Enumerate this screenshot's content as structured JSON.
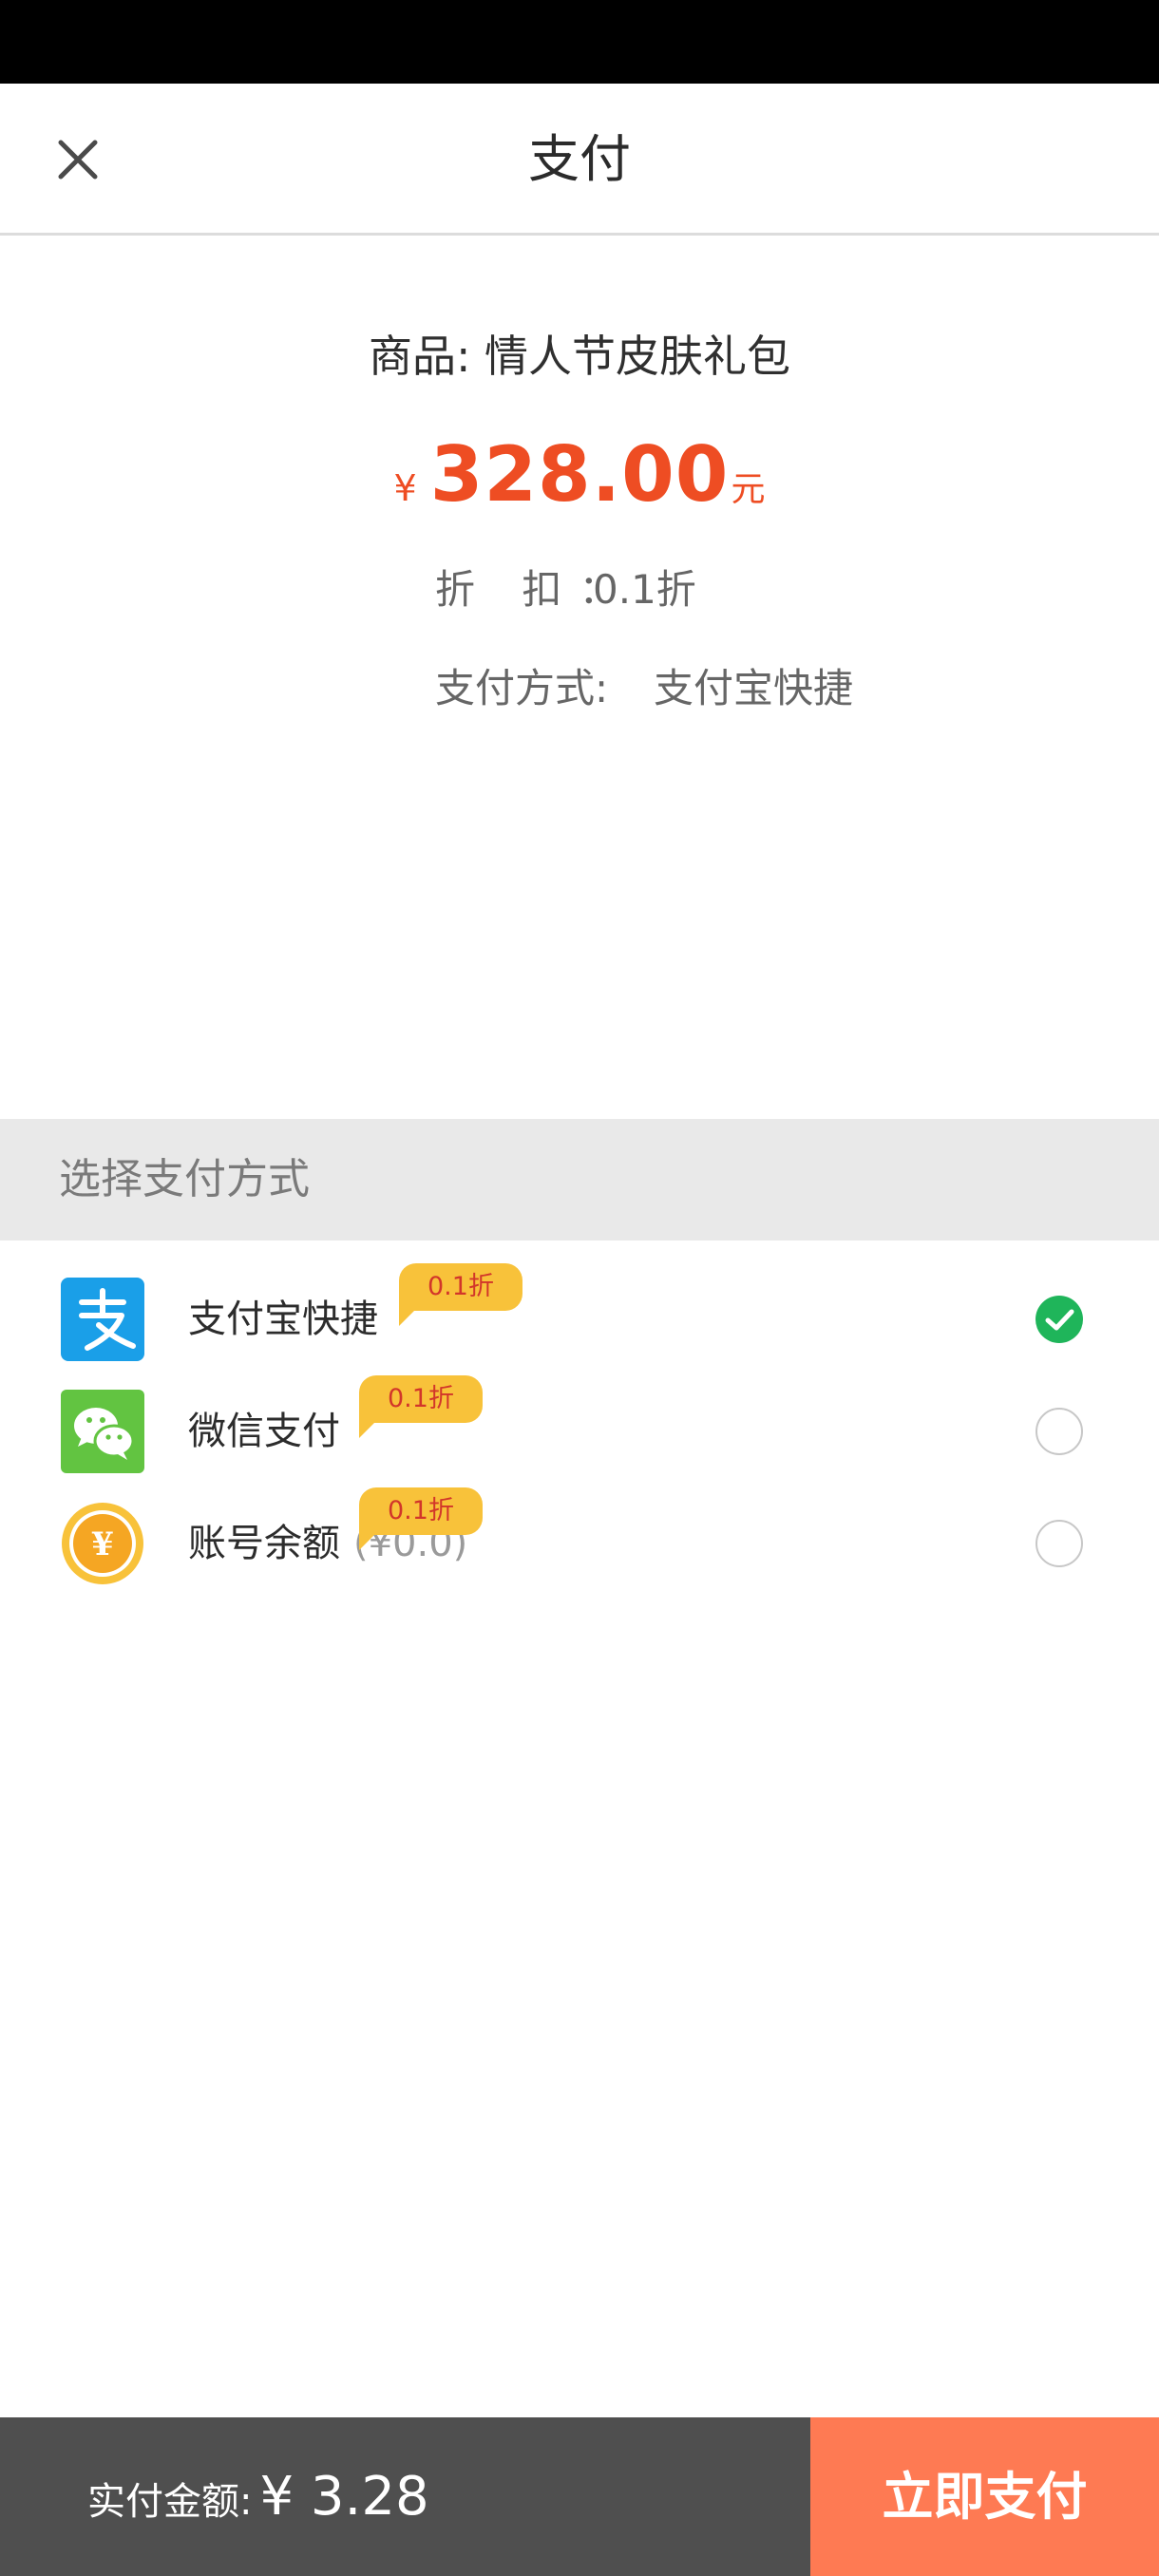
{
  "header": {
    "title": "支付",
    "close_icon": "close-icon"
  },
  "product": {
    "label": "商品: 情人节皮肤礼包",
    "price_symbol": "¥",
    "price": "328.00",
    "price_unit": "元",
    "discount_label": "折 扣：",
    "discount_value": "0.1折",
    "method_label": "支付方式:",
    "method_value": "支付宝快捷"
  },
  "payment": {
    "section_title": "选择支付方式",
    "options": [
      {
        "icon": "alipay-icon",
        "label": "支付宝快捷",
        "extra": "",
        "badge": "0.1折",
        "selected": true
      },
      {
        "icon": "wechat-pay-icon",
        "label": "微信支付",
        "extra": "",
        "badge": "0.1折",
        "selected": false
      },
      {
        "icon": "coin-balance-icon",
        "label": "账号余额",
        "extra": "(¥0.0)",
        "badge": "0.1折",
        "selected": false
      }
    ]
  },
  "footer": {
    "total_label": "实付金额:",
    "total_value": "¥ 3.28",
    "pay_button": "立即支付"
  },
  "colors": {
    "price": "#ee4d23",
    "alipay": "#1a9fe8",
    "wechat": "#62c441",
    "badge": "#f8c23a",
    "selected": "#1fb55a",
    "pay_button": "#fe7a53",
    "bottom_bar": "#4f4f4f"
  }
}
